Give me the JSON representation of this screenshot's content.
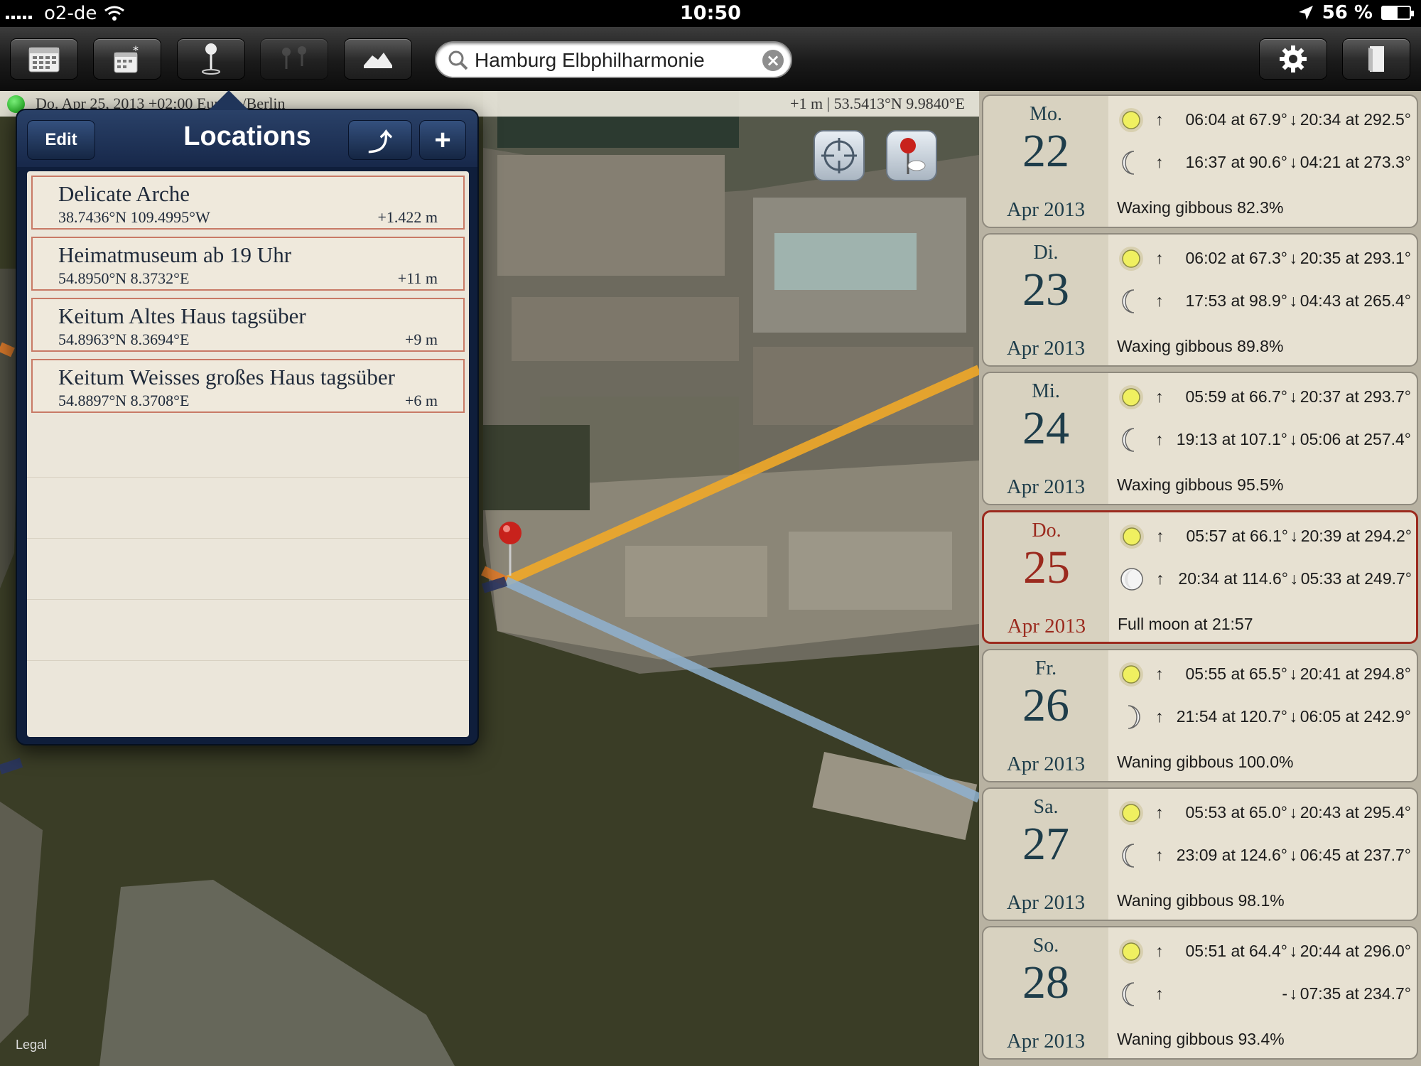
{
  "status": {
    "carrier": "o2-de",
    "time": "10:50",
    "battery": "56 %",
    "battery_level": 0.56
  },
  "toolbar": {
    "buttons": [
      "calendar-icon",
      "calendar-star-icon",
      "location-pin-icon",
      "compare-pins-icon",
      "horizon-icon",
      "gear-icon",
      "book-icon"
    ],
    "search_value": "Hamburg Elbphilharmonie"
  },
  "infobar": {
    "left": "Do. Apr 25, 2013 +02:00 Europe/Berlin",
    "right": "+1 m | 53.5413°N 9.9840°E"
  },
  "locations": {
    "title": "Locations",
    "edit_label": "Edit",
    "share_label": "⤴",
    "add_label": "+",
    "items": [
      {
        "name": "Delicate Arche",
        "coords": "38.7436°N 109.4995°W",
        "alt": "+1.422 m"
      },
      {
        "name": "Heimatmuseum ab 19 Uhr",
        "coords": "54.8950°N 8.3732°E",
        "alt": "+11 m"
      },
      {
        "name": "Keitum Altes Haus tagsüber",
        "coords": "54.8963°N 8.3694°E",
        "alt": "+9 m"
      },
      {
        "name": "Keitum Weisses großes Haus tagsüber",
        "coords": "54.8897°N 8.3708°E",
        "alt": "+6 m"
      }
    ]
  },
  "map": {
    "legal": "Legal"
  },
  "days": [
    {
      "dow": "Mo.",
      "num": "22",
      "month": "Apr 2013",
      "sun_rise": "06:04 at 67.9°",
      "sun_set": "20:34 at 292.5°",
      "moon_rise": "16:37 at 90.6°",
      "moon_set": "04:21 at 273.3°",
      "phase": "Waxing gibbous 82.3%"
    },
    {
      "dow": "Di.",
      "num": "23",
      "month": "Apr 2013",
      "sun_rise": "06:02 at 67.3°",
      "sun_set": "20:35 at 293.1°",
      "moon_rise": "17:53 at 98.9°",
      "moon_set": "04:43 at 265.4°",
      "phase": "Waxing gibbous 89.8%"
    },
    {
      "dow": "Mi.",
      "num": "24",
      "month": "Apr 2013",
      "sun_rise": "05:59 at 66.7°",
      "sun_set": "20:37 at 293.7°",
      "moon_rise": "19:13 at 107.1°",
      "moon_set": "05:06 at 257.4°",
      "phase": "Waxing gibbous 95.5%"
    },
    {
      "dow": "Do.",
      "num": "25",
      "month": "Apr 2013",
      "sun_rise": "05:57 at 66.1°",
      "sun_set": "20:39 at 294.2°",
      "moon_rise": "20:34 at 114.6°",
      "moon_set": "05:33 at 249.7°",
      "phase": "Full moon at 21:57"
    },
    {
      "dow": "Fr.",
      "num": "26",
      "month": "Apr 2013",
      "sun_rise": "05:55 at 65.5°",
      "sun_set": "20:41 at 294.8°",
      "moon_rise": "21:54 at 120.7°",
      "moon_set": "06:05 at 242.9°",
      "phase": "Waning gibbous 100.0%"
    },
    {
      "dow": "Sa.",
      "num": "27",
      "month": "Apr 2013",
      "sun_rise": "05:53 at 65.0°",
      "sun_set": "20:43 at 295.4°",
      "moon_rise": "23:09 at 124.6°",
      "moon_set": "06:45 at 237.7°",
      "phase": "Waning gibbous 98.1%"
    },
    {
      "dow": "So.",
      "num": "28",
      "month": "Apr 2013",
      "sun_rise": "05:51 at 64.4°",
      "sun_set": "20:44 at 296.0°",
      "moon_rise": "-",
      "moon_set": "07:35 at 234.7°",
      "phase": "Waning gibbous 93.4%"
    }
  ],
  "colors": {
    "sun_line": "#f0a828",
    "moon_line": "#8fb2d0",
    "today_border": "#9b2a1e",
    "popover": "#0f1e3b"
  }
}
